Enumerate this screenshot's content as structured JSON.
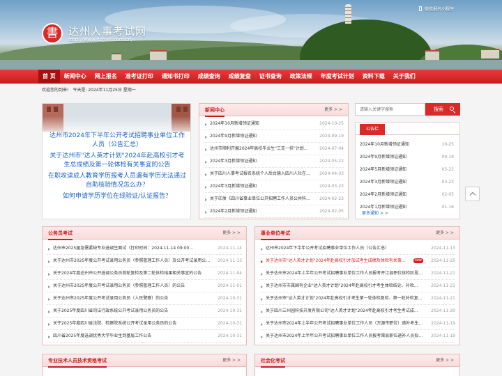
{
  "header": {
    "site_name": "达州人事考试网",
    "site_url": "http://www.dzrsks.com.cn/",
    "logo_glyph": "書",
    "mini_program": "微信报名小程序"
  },
  "nav": {
    "items": [
      "首 页",
      "新闻中心",
      "网上报名",
      "准考证打印",
      "通知书打印",
      "成绩查询",
      "成绩复查",
      "证书查询",
      "政策法规",
      "年度考试计划",
      "资料下载",
      "关于我们"
    ]
  },
  "welcome": {
    "greeting": "欢迎您的到来!",
    "today": "今天是: 2024年11月25日 星期一"
  },
  "slideshow": {
    "links": [
      "达州市2024年下半年公开考试招聘事业单位工作人员（公告汇总）",
      "关于达州市\"达人英才计划\"2024年赴高校引才考生总成绩及第一轮体检有关事宜的公告",
      "在职攻读成人教育学历报考人员遇有学历无法通过自助核验情况怎么办？",
      "如何申请学历学位在线验证/认证报告？"
    ]
  },
  "news": {
    "title": "新闻中心",
    "more": "更多 > >",
    "items": [
      {
        "title": "2024年10月新增领证通知",
        "date": "2024-10-25"
      },
      {
        "title": "2024年9月新增领证通知",
        "date": "2024-09-19"
      },
      {
        "title": "达州市顺利开展2024年高校毕业生\"三支一扶\"计划…",
        "date": "2024-07-04"
      },
      {
        "title": "2024年3月新增领证通知",
        "date": "2024-05-22"
      },
      {
        "title": "关于四川人事考试报名系统个人后台输入四川人社在…",
        "date": "2024-04-03"
      },
      {
        "title": "2024年3月新增领证通知",
        "date": "2024-03-23"
      },
      {
        "title": "关于印发《四川省事业单位公开招聘工作人员公共科…",
        "date": "2024-02-23"
      },
      {
        "title": "2024年2月新增领证通知",
        "date": "2024-02-05"
      }
    ]
  },
  "search": {
    "placeholder": "请输入关键字搜索",
    "button": "搜索"
  },
  "notice": {
    "tab": "公告栏",
    "more": "更多通知 > >",
    "items": [
      {
        "title": "2024年10月新增领证通知",
        "date": "10-25"
      },
      {
        "title": "2024年9月新增领证通知",
        "date": "09-19"
      },
      {
        "title": "2024年5月新增领证通知",
        "date": "05-22"
      },
      {
        "title": "2024年3月新增领证通知",
        "date": "03-23"
      },
      {
        "title": "2024年2月新增领证通知",
        "date": "02-05"
      },
      {
        "title": "2024年1月新增领证通知",
        "date": "01-16"
      }
    ]
  },
  "civil": {
    "title": "公务员考试",
    "more": "更多 > >",
    "items": [
      {
        "title": "达州市2025届急需紧缺专业选调生面试（打印时间：2024-11-14 09:00…",
        "date": "2024-11-14"
      },
      {
        "title": "关于达州市2025年度公开考试录用公务员（参照管理工作人员）及公开考试录用公…",
        "date": "2024-11-13"
      },
      {
        "title": "关于2024年度达州市公开选调公务员首轮复检及第二轮体检结果相关事宜的公告",
        "date": "2024-11-04"
      },
      {
        "title": "关于达州市2025年度公开考试录用公务员（参照管理工作人员）的公告",
        "date": "2024-11-01"
      },
      {
        "title": "关于达州市2025年度公开考试录用公务员（人民警察）的公告",
        "date": "2024-10-31"
      },
      {
        "title": "关于2025年度四川省司法行政系统公开考试录用公务员的公告",
        "date": "2024-10-31"
      },
      {
        "title": "关于2025年度四川省法院、检察院系统公开考试录用公务员的公告",
        "date": "2024-10-31"
      },
      {
        "title": "四川省2025年度选调优秀大学毕业生到基层工作公告",
        "date": "2024-10-31"
      }
    ]
  },
  "institution": {
    "title": "事业单位考试",
    "more": "更多 > >",
    "new_badge": "new",
    "items": [
      {
        "title": "达州市2024年下半年公开考试招聘事业单位工作人员（公告汇总）",
        "date": "2024-11-13",
        "red": false
      },
      {
        "title": "关于达州市\"达人英才计划\"2024年赴高校引才加试考生成绩及体检有关事宜的公告",
        "date": "2024-11-25",
        "red": true
      },
      {
        "title": "关于达州市2024年上半年公开考试招聘事业单位工作人员报考开江县职位体检阶段补…",
        "date": "2024-11-21",
        "red": false
      },
      {
        "title": "关于达州市市属国有企业\"达人英才计划\"2024年赴高校引才考生体检结论、补检…",
        "date": "2024-11-21",
        "red": false
      },
      {
        "title": "关于达州市\"达人英才计划\"2024年赴高校引才考生第一轮体检复检、第一轮补检复…",
        "date": "2024-11-21",
        "red": false
      },
      {
        "title": "关于四川三州园科技开发有限公司\"达人英才计划\"2024年赴高校引才考生考试成…",
        "date": "2024-11-20",
        "red": false
      },
      {
        "title": "关于达州市2024年上半年公开考试招聘事业单位工作人员（万源市职位）递补考生…",
        "date": "2024-11-19",
        "red": false
      },
      {
        "title": "关于达州市2024年上半年公开考试招聘事业单位工作人员报考渠县职位递补人员拟…",
        "date": "2024-11-19",
        "red": false
      }
    ]
  },
  "professional": {
    "title": "专业技术人员技术资格考试",
    "more": "更多 > >"
  },
  "social": {
    "title": "社会化考试",
    "more": "更多 > >"
  }
}
